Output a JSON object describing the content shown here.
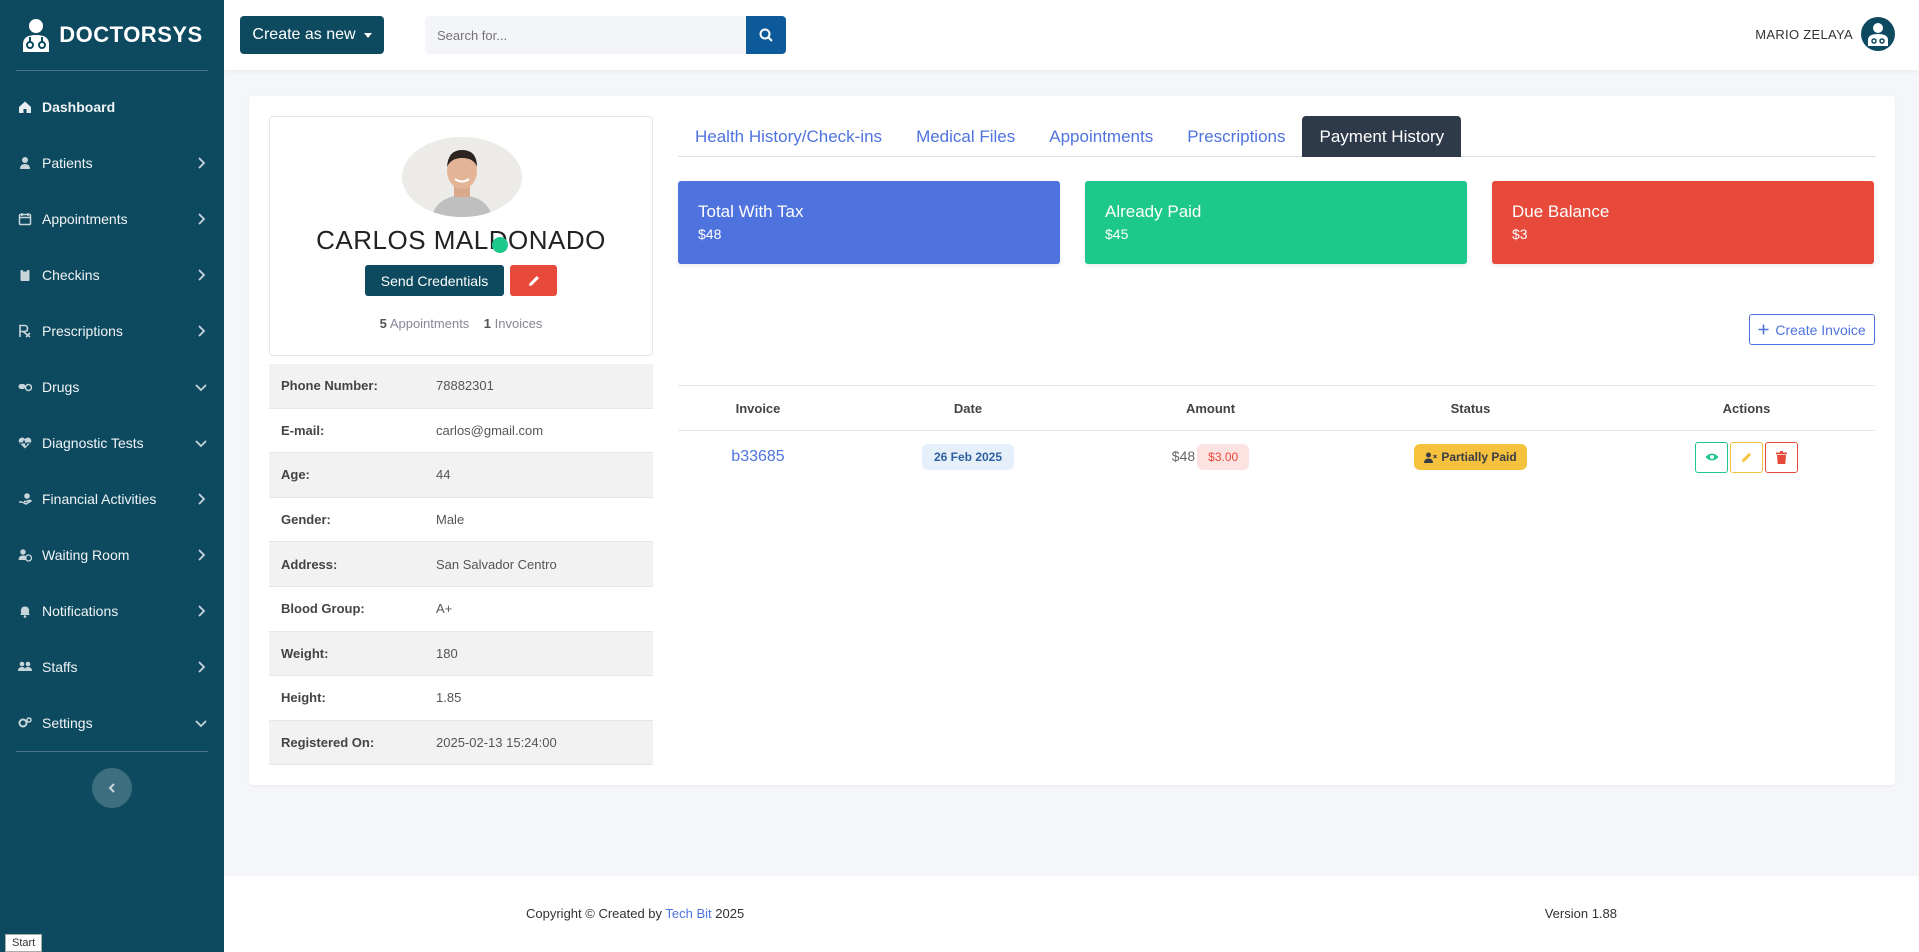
{
  "brand": {
    "name": "DOCTORSYS",
    "logo_icon": "doctor-icon"
  },
  "sidebar": {
    "items": [
      {
        "label": "Dashboard",
        "icon": "home-icon",
        "expand": "none",
        "active": true
      },
      {
        "label": "Patients",
        "icon": "user-injured-icon",
        "expand": "right"
      },
      {
        "label": "Appointments",
        "icon": "calendar-icon",
        "expand": "right"
      },
      {
        "label": "Checkins",
        "icon": "clipboard-icon",
        "expand": "right"
      },
      {
        "label": "Prescriptions",
        "icon": "prescription-icon",
        "expand": "right"
      },
      {
        "label": "Drugs",
        "icon": "pills-icon",
        "expand": "down"
      },
      {
        "label": "Diagnostic Tests",
        "icon": "heartbeat-icon",
        "expand": "down"
      },
      {
        "label": "Financial Activities",
        "icon": "hand-holding-dollar-icon",
        "expand": "right"
      },
      {
        "label": "Waiting Room",
        "icon": "users-clock-icon",
        "expand": "right"
      },
      {
        "label": "Notifications",
        "icon": "bell-icon",
        "expand": "right"
      },
      {
        "label": "Staffs",
        "icon": "users-icon",
        "expand": "right"
      },
      {
        "label": "Settings",
        "icon": "cogs-icon",
        "expand": "down"
      }
    ],
    "start_label": "Start"
  },
  "topbar": {
    "create_label": "Create as new",
    "search_placeholder": "Search for...",
    "user_name": "MARIO ZELAYA"
  },
  "profile": {
    "name": "CARLOS MALDONADO",
    "send_label": "Send Credentials",
    "appointments_count": "5",
    "appointments_label": "Appointments",
    "invoices_count": "1",
    "invoices_label": "Invoices",
    "online": true
  },
  "info": [
    {
      "key": "Phone Number:",
      "value": "78882301"
    },
    {
      "key": "E-mail:",
      "value": "carlos@gmail.com"
    },
    {
      "key": "Age:",
      "value": "44"
    },
    {
      "key": "Gender:",
      "value": "Male"
    },
    {
      "key": "Address:",
      "value": "San Salvador Centro"
    },
    {
      "key": "Blood Group:",
      "value": "A+"
    },
    {
      "key": "Weight:",
      "value": "180"
    },
    {
      "key": "Height:",
      "value": "1.85"
    },
    {
      "key": "Registered On:",
      "value": "2025-02-13 15:24:00"
    }
  ],
  "tabs": [
    {
      "label": "Health History/Check-ins",
      "active": false
    },
    {
      "label": "Medical Files",
      "active": false
    },
    {
      "label": "Appointments",
      "active": false
    },
    {
      "label": "Prescriptions",
      "active": false
    },
    {
      "label": "Payment History",
      "active": true
    }
  ],
  "stats": {
    "total": {
      "title": "Total With Tax",
      "value": "$48",
      "color": "#4e73df"
    },
    "paid": {
      "title": "Already Paid",
      "value": "$45",
      "color": "#1cc88a"
    },
    "due": {
      "title": "Due Balance",
      "value": "$3",
      "color": "#e74a3b"
    }
  },
  "create_invoice_label": "Create Invoice",
  "table": {
    "headers": [
      "Invoice",
      "Date",
      "Amount",
      "Status",
      "Actions"
    ],
    "rows": [
      {
        "invoice": "b33685",
        "date": "26 Feb 2025",
        "amount": "$48",
        "due": "$3.00",
        "status": "Partially Paid"
      }
    ]
  },
  "footer": {
    "copy_prefix": "Copyright © Created by",
    "copy_link": "Tech Bit",
    "copy_year": "2025",
    "version": "Version 1.88"
  }
}
